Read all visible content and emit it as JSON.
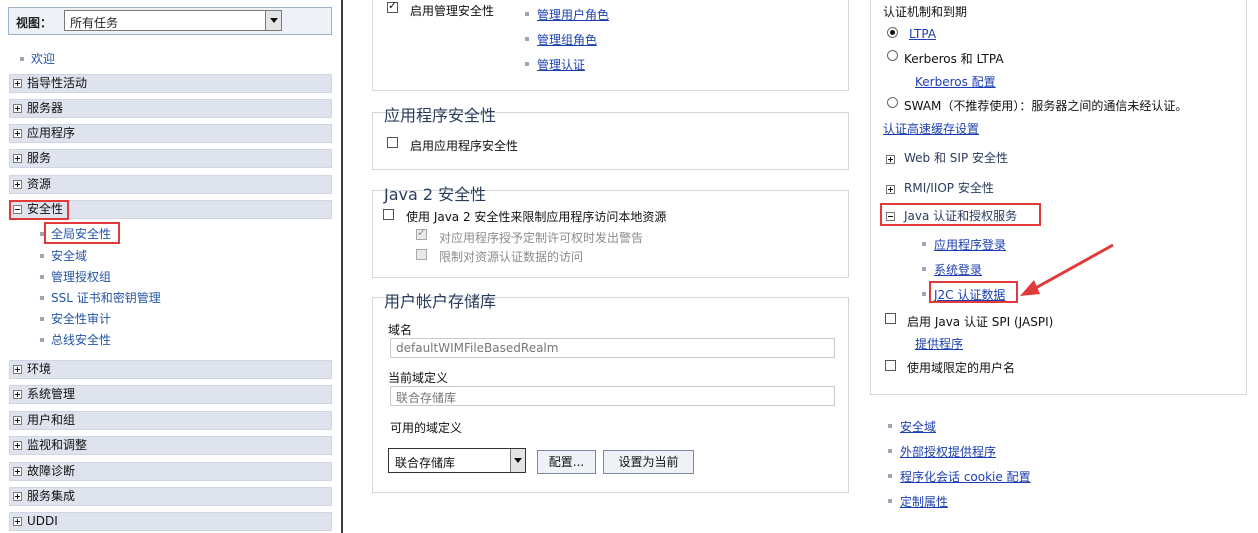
{
  "nav": {
    "view_label": "视图：",
    "view_value": "所有任务",
    "welcome": "欢迎",
    "categories_top": [
      "指导性活动",
      "服务器",
      "应用程序",
      "服务",
      "资源"
    ],
    "security": "安全性",
    "security_items": [
      "全局安全性",
      "安全域",
      "管理授权组",
      "SSL 证书和密钥管理",
      "安全性审计",
      "总线安全性"
    ],
    "categories_bottom": [
      "环境",
      "系统管理",
      "用户和组",
      "监视和调整",
      "故障诊断",
      "服务集成",
      "UDDI"
    ]
  },
  "admin": {
    "enable_admin_security": "启用管理安全性",
    "links": [
      "管理用户角色",
      "管理组角色",
      "管理认证"
    ]
  },
  "app_security": {
    "title": "应用程序安全性",
    "enable": "启用应用程序安全性"
  },
  "java2": {
    "title": "Java 2 安全性",
    "use": "使用 Java 2 安全性来限制应用程序访问本地资源",
    "warn": "对应用程序授予定制许可权时发出警告",
    "restrict": "限制对资源认证数据的访问"
  },
  "registry": {
    "title": "用户帐户存储库",
    "realm_label": "域名",
    "realm_value": "defaultWIMFileBasedRealm",
    "current_label": "当前域定义",
    "current_value": "联合存储库",
    "available_label": "可用的域定义",
    "available_value": "联合存储库",
    "configure_btn": "配置...",
    "set_current_btn": "设置为当前"
  },
  "auth": {
    "heading": "认证机制和到期",
    "ltpa": "LTPA",
    "kerberos": "Kerberos 和 LTPA",
    "kerberos_config": "Kerberos 配置",
    "swam": "SWAM（不推荐使用）：服务器之间的通信未经认证。",
    "cache": "认证高速缓存设置",
    "web_sip": "Web 和 SIP 安全性",
    "rmi": "RMI/IIOP 安全性",
    "jaas": "Java 认证和授权服务",
    "jaas_items": [
      "应用程序登录",
      "系统登录",
      "J2C 认证数据"
    ],
    "jaspi": "启用 Java 认证 SPI (JASPI)",
    "providers": "提供程序",
    "realm_qualified": "使用域限定的用户名"
  },
  "related": [
    "安全域",
    "外部授权提供程序",
    "程序化会话 cookie 配置",
    "定制属性"
  ],
  "colors": {
    "highlight": "#e03a3a",
    "link": "#1b3fb0",
    "nav_bg": "#dfe3ee"
  }
}
